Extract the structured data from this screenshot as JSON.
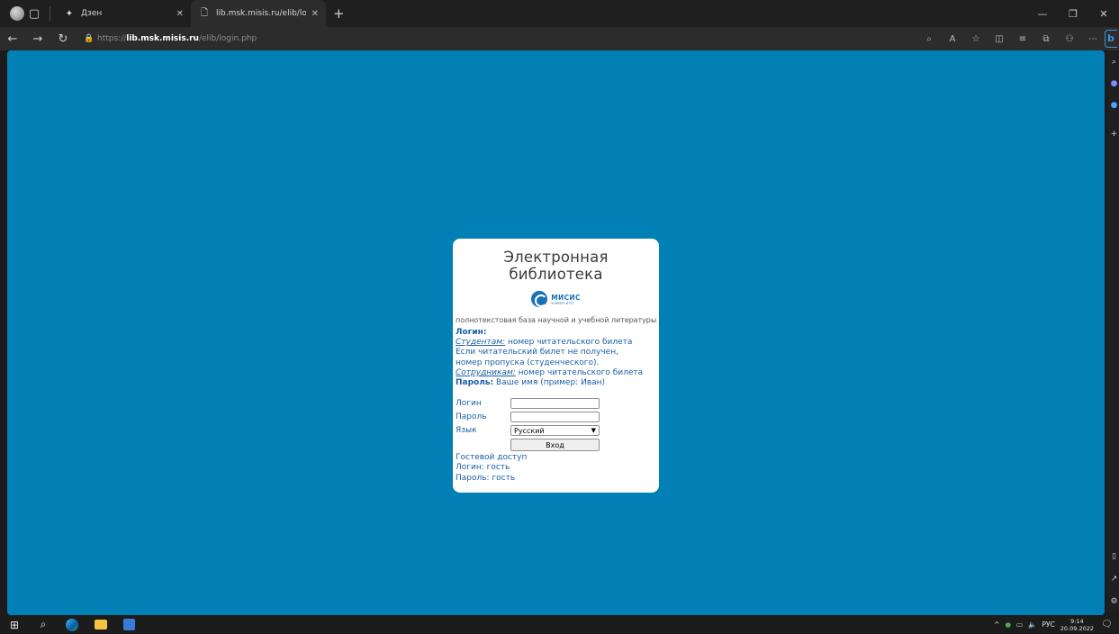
{
  "browser": {
    "tabs": [
      {
        "title": "Дзен",
        "icon": "sparkle-icon",
        "active": false
      },
      {
        "title": "lib.msk.misis.ru/elib/login.php",
        "icon": "page-icon",
        "active": true
      }
    ],
    "url": {
      "prefix": "https://",
      "host": "lib.msk.misis.ru",
      "path": "/elib/login.php"
    }
  },
  "card": {
    "title": "Электронная библиотека",
    "logo_name": "МИСИС",
    "logo_sub": "УНИВЕРСИТЕТ",
    "subtitle": "полнотекстовая база научной и учебной литературы",
    "login_heading": "Логин:",
    "students_label": "Студентам:",
    "students_text": " номер читательского билета",
    "no_ticket_1": "Если читательский билет не получен,",
    "no_ticket_2": "номер пропуска (студенческого).",
    "staff_label": "Сотрудникам:",
    "staff_text": " номер читательского билета",
    "password_label": "Пароль:",
    "password_text": " Ваше имя (пример: Иван)"
  },
  "form": {
    "login_label": "Логин",
    "login_value": "",
    "password_label": "Пароль",
    "password_value": "",
    "language_label": "Язык",
    "language_selected": "Русский",
    "submit_label": "Вход"
  },
  "guest": {
    "link": "Гостевой доступ",
    "login": "Логин: гость",
    "password": "Пароль: гость"
  },
  "taskbar": {
    "lang": "РУС",
    "time": "9:14",
    "date": "20.09.2022"
  }
}
